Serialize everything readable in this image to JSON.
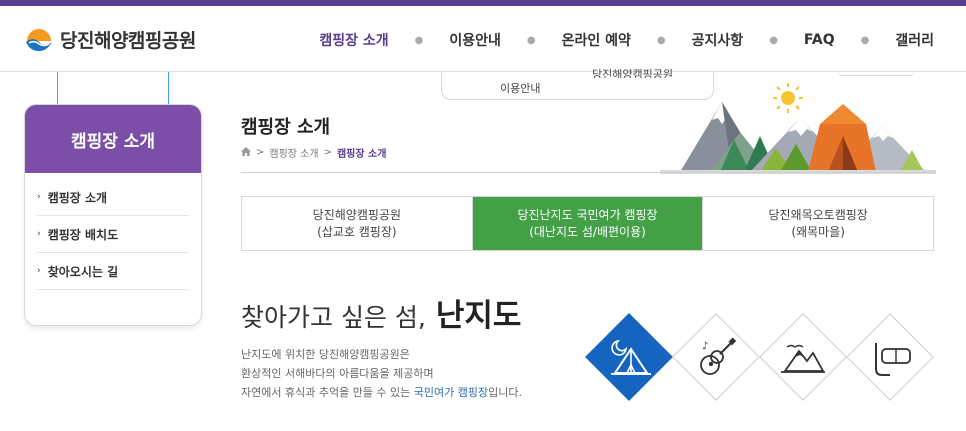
{
  "site": {
    "name": "당진해양캠핑공원"
  },
  "nav": {
    "items": [
      "캠핑장 소개",
      "이용안내",
      "온라인 예약",
      "공지사항",
      "FAQ",
      "갤러리"
    ],
    "active_index": 0,
    "dropdown": [
      "이용안내",
      "당진해양캠핑공원"
    ]
  },
  "sidebar": {
    "title": "캠핑장 소개",
    "items": [
      "캠핑장 소개",
      "캠핑장 배치도",
      "찾아오시는 길"
    ]
  },
  "page": {
    "title": "캠핑장 소개",
    "breadcrumb": [
      "캠핑장 소개",
      "캠핑장 소개"
    ]
  },
  "tabs": [
    {
      "line1": "당진해양캠핑공원",
      "line2": "(삽교호 캠핑장)"
    },
    {
      "line1": "당진난지도 국민여가 캠핑장",
      "line2": "(대난지도 섬/배편이용)"
    },
    {
      "line1": "당진왜목오토캠핑장",
      "line2": "(왜목마을)"
    }
  ],
  "active_tab": 1,
  "headline": {
    "prefix": "찾아가고 싶은 섬,",
    "strong": "난지도"
  },
  "description": {
    "line1": "난지도에 위치한 당진해양캠핑공원은",
    "line2": "환상적인 서해바다의 아름다움을 제공하며",
    "line3_prefix": "자연에서 휴식과 추억을 만들 수 있는 ",
    "line3_highlight": "국민여가 캠핑장",
    "line3_suffix": "입니다."
  },
  "icons": [
    "camping-tent-icon",
    "guitar-icon",
    "mountain-icon",
    "snorkel-icon"
  ],
  "colors": {
    "brand": "#5b3d8f",
    "sidebar_head": "#7b4fa8",
    "active_tab": "#43a047",
    "active_icon": "#1565c0",
    "highlight": "#2a6db5"
  }
}
